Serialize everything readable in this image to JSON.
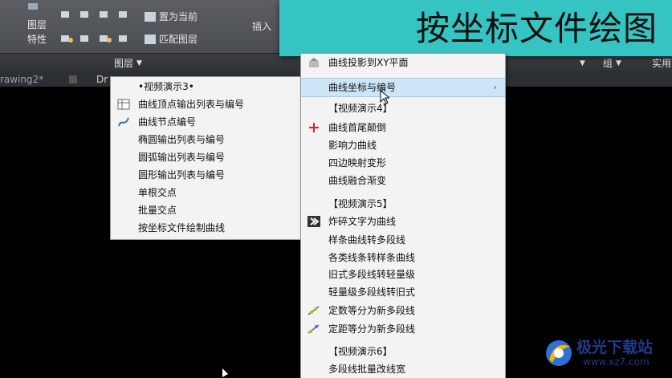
{
  "banner": {
    "title": "按坐标文件绘图"
  },
  "ribbon": {
    "layer_label_1": "图层",
    "layer_label_2": "特性",
    "set_current": "置为当前",
    "match_layer": "匹配图层",
    "insert": "插入",
    "panel_layer": "图层",
    "panel_group": "组",
    "panel_util": "实用"
  },
  "tabs": [
    "rawing2*",
    "Dr"
  ],
  "left_menu": {
    "items": [
      {
        "label": "•视频演示3•",
        "icon": ""
      },
      {
        "label": "曲线顶点输出列表与编号",
        "icon": "table-icon"
      },
      {
        "label": "曲线节点编号",
        "icon": "curve-number-icon"
      },
      {
        "label": "椭圆输出列表与编号",
        "icon": ""
      },
      {
        "label": "圆弧输出列表与编号",
        "icon": ""
      },
      {
        "label": "圆形输出列表与编号",
        "icon": ""
      },
      {
        "label": "单根交点",
        "icon": ""
      },
      {
        "label": "批量交点",
        "icon": ""
      },
      {
        "label": "按坐标文件绘制曲线",
        "icon": ""
      }
    ]
  },
  "right_menu": {
    "items": [
      {
        "label": "曲线投影到XY平面",
        "icon": "projection-icon",
        "highlight": false
      },
      {
        "label": "曲线坐标与编号",
        "icon": "",
        "highlight": true,
        "submenu": "›"
      },
      {
        "label": "【视频演示4】",
        "icon": "",
        "highlight": false
      },
      {
        "label": "曲线首尾颠倒",
        "icon": "move-icon",
        "highlight": false
      },
      {
        "label": "影响力曲线",
        "icon": "",
        "highlight": false
      },
      {
        "label": "四边映射变形",
        "icon": "",
        "highlight": false
      },
      {
        "label": "曲线融合渐变",
        "icon": "",
        "highlight": false
      },
      {
        "label": "【视频演示5】",
        "icon": "",
        "highlight": false
      },
      {
        "label": "炸碎文字为曲线",
        "icon": "explode-text-icon",
        "highlight": false
      },
      {
        "label": "样条曲线转多段线",
        "icon": "",
        "highlight": false
      },
      {
        "label": "各类线条转样条曲线",
        "icon": "",
        "highlight": false
      },
      {
        "label": "旧式多段线转轻量级",
        "icon": "",
        "highlight": false
      },
      {
        "label": "轻量级多段线转旧式",
        "icon": "",
        "highlight": false
      },
      {
        "label": "定数等分为新多段线",
        "icon": "divide-icon",
        "highlight": false
      },
      {
        "label": "定距等分为新多段线",
        "icon": "measure-icon",
        "highlight": false
      },
      {
        "label": "【视频演示6】",
        "icon": "",
        "highlight": false
      },
      {
        "label": "多段线批量改线宽",
        "icon": "",
        "highlight": false
      }
    ]
  },
  "watermark": {
    "name": "极光下载站",
    "url": "www.xz7.com"
  }
}
